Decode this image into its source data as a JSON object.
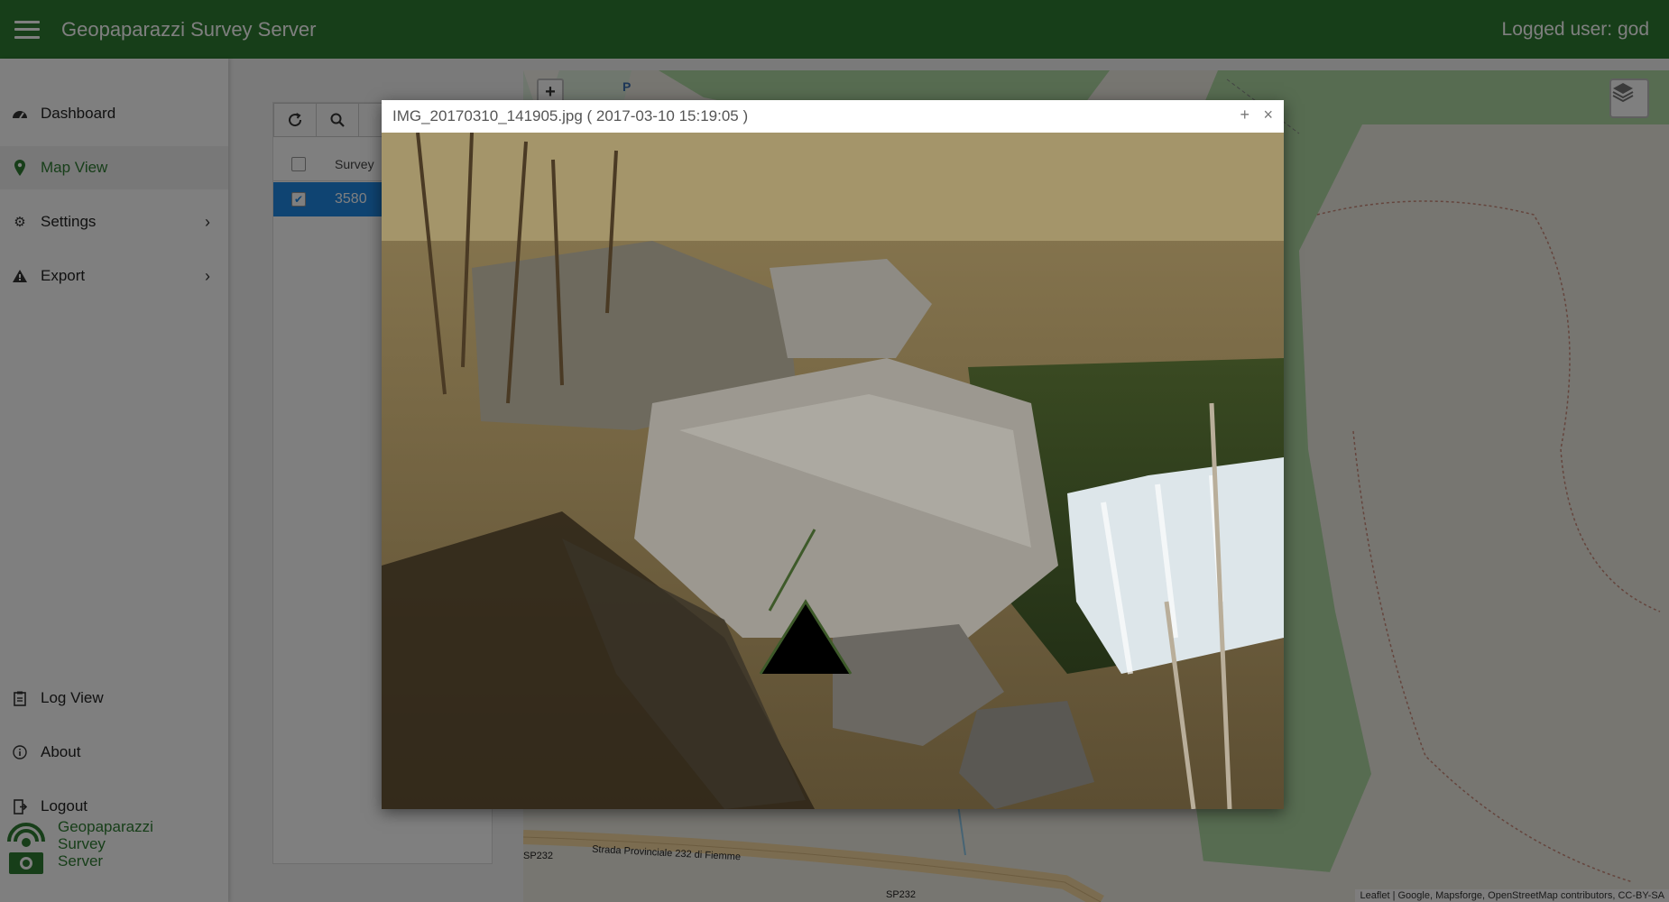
{
  "header": {
    "app_title": "Geopaparazzi Survey Server",
    "logged_user": "Logged user: god"
  },
  "sidebar": {
    "items": [
      {
        "label": "Dashboard",
        "icon": "dashboard-icon"
      },
      {
        "label": "Map View",
        "icon": "map-marker-icon",
        "active": true
      },
      {
        "label": "Settings",
        "icon": "settings-icon"
      },
      {
        "label": "Export",
        "icon": "export-icon"
      },
      {
        "label": "Log View",
        "icon": "clipboard-icon"
      },
      {
        "label": "About",
        "icon": "info-icon"
      },
      {
        "label": "Logout",
        "icon": "logout-icon"
      }
    ],
    "brand": [
      "Geopaparazzi",
      "Survey",
      "Server"
    ]
  },
  "panel": {
    "column_survey": "Survey",
    "row_value": "3580",
    "row_checked": true
  },
  "map": {
    "zoom_in": "+",
    "poi_label": "P",
    "road_name": "Strada Provinciale 232 di Fiemme",
    "road_code": "SP232",
    "attribution": "Leaflet | Google, Mapsforge, OpenStreetMap contributors, CC-BY-SA"
  },
  "modal": {
    "title": "IMG_20170310_141905.jpg ( 2017-03-10 15:19:05 )",
    "maximize": "+",
    "close": "×"
  },
  "colors": {
    "brand_green": "#2e7d32",
    "selection_blue": "#1e88e5",
    "forest_green": "#aed9a2"
  }
}
